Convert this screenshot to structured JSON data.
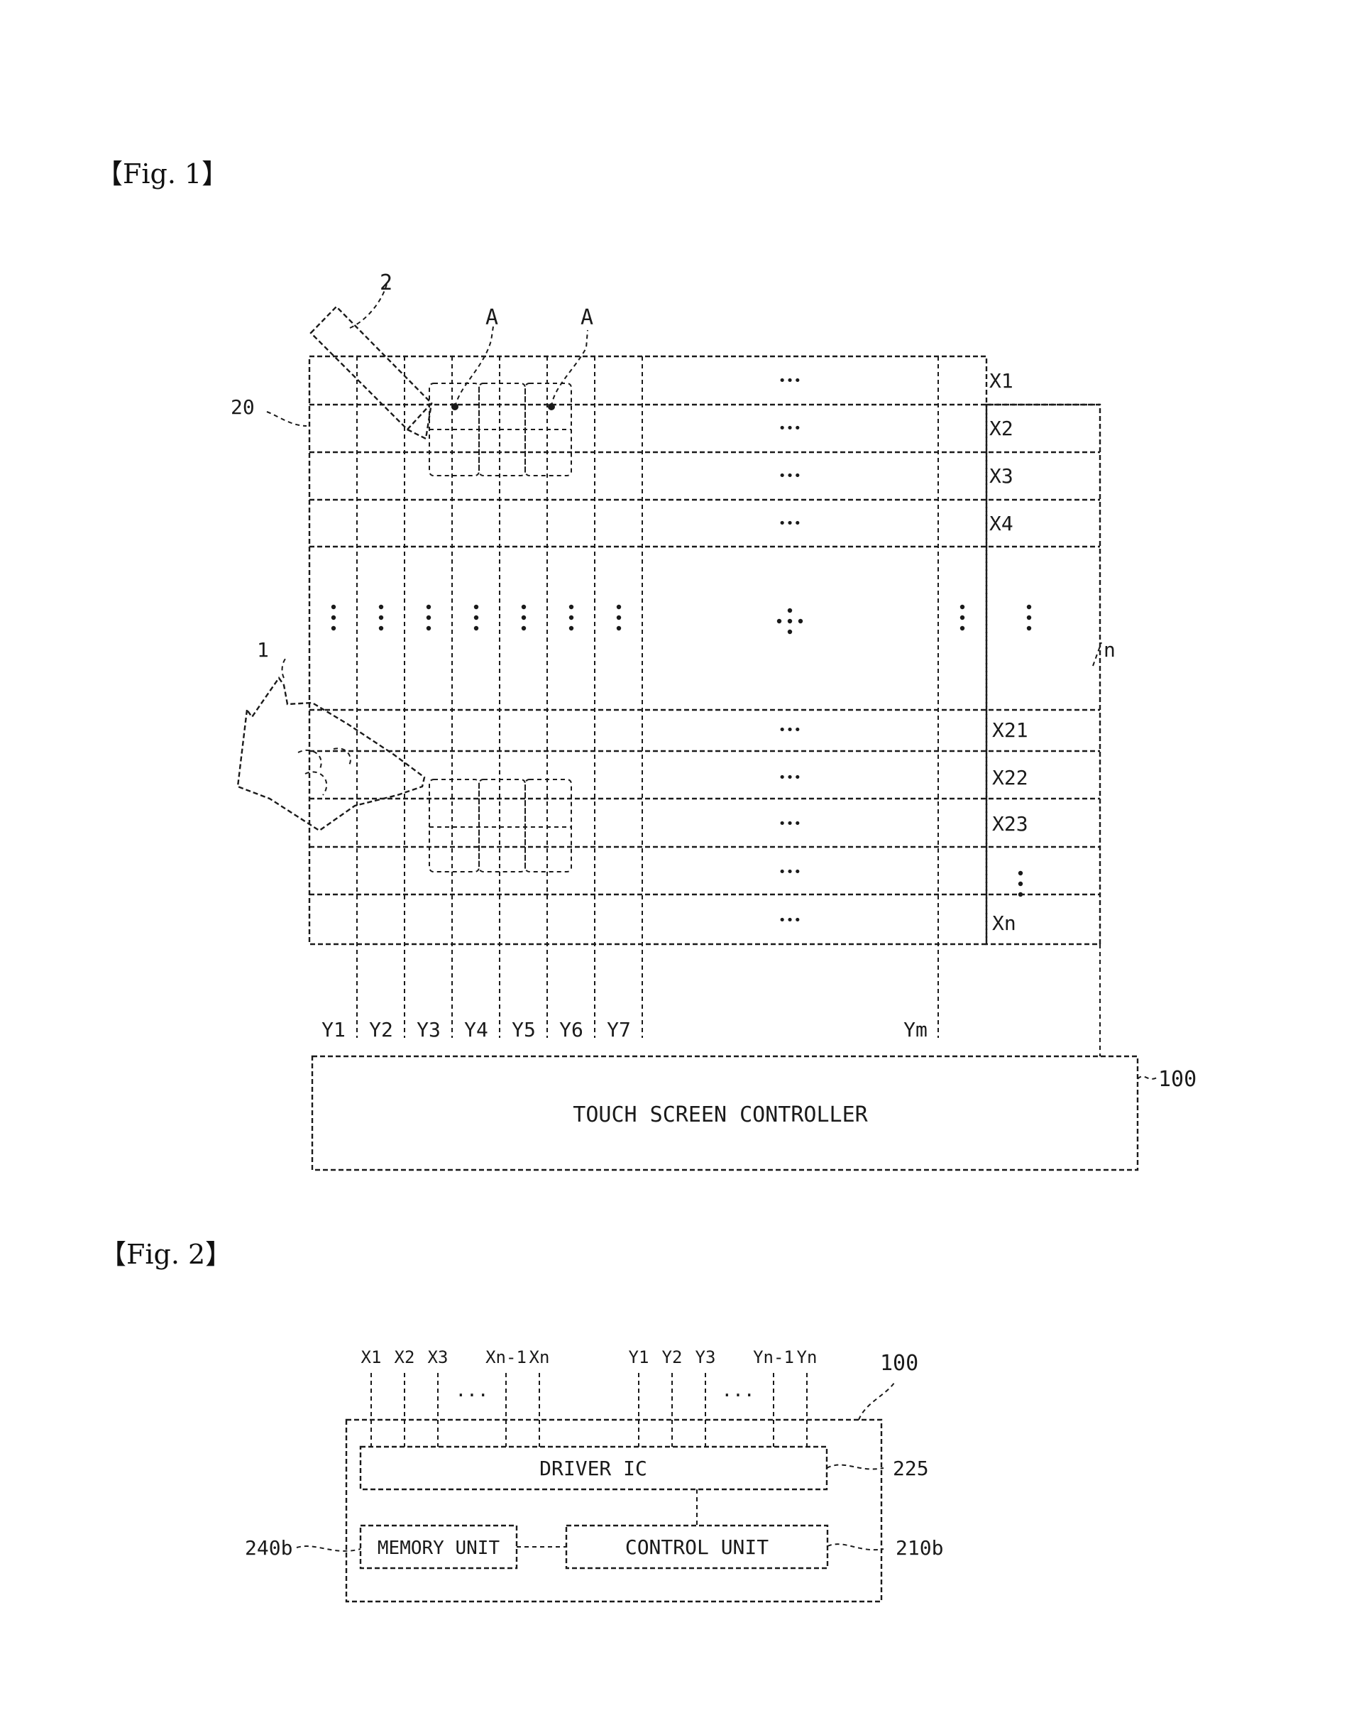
{
  "fig1": {
    "title": "【Fig. 1】",
    "pen_ref": "2",
    "finger_ref": "1",
    "panel_ref": "20",
    "point_labels": [
      "A",
      "A"
    ],
    "n_ref": "n",
    "x_lines": [
      "X1",
      "X2",
      "X3",
      "X4",
      "X21",
      "X22",
      "X23",
      "Xn"
    ],
    "y_lines": [
      "Y1",
      "Y2",
      "Y3",
      "Y4",
      "Y5",
      "Y6",
      "Y7",
      "Ym"
    ],
    "controller_label": "TOUCH SCREEN CONTROLLER",
    "controller_ref": "100",
    "ellipsis": "•••"
  },
  "fig2": {
    "title": "【Fig. 2】",
    "x_inputs": [
      "X1",
      "X2",
      "X3",
      "Xn-1",
      "Xn"
    ],
    "y_inputs": [
      "Y1",
      "Y2",
      "Y3",
      "Yn-1",
      "Yn"
    ],
    "ellipsis": "...",
    "block_ref": "100",
    "driver_label": "DRIVER IC",
    "driver_ref": "225",
    "control_label": "CONTROL UNIT",
    "control_ref": "210b",
    "memory_label": "MEMORY UNIT",
    "memory_ref": "240b"
  }
}
